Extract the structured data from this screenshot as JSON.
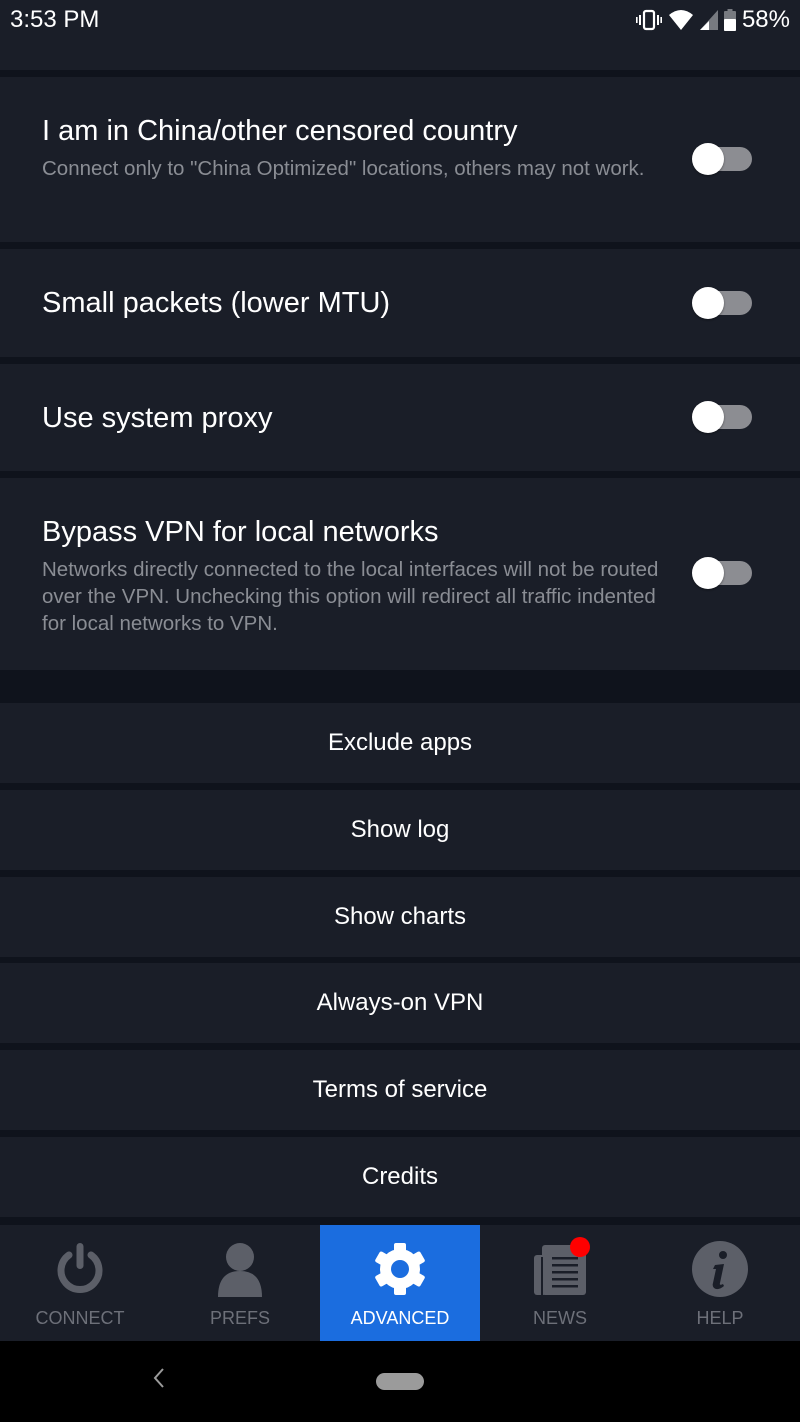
{
  "status_bar": {
    "time": "3:53 PM",
    "icons": [
      "vibrate-icon",
      "wifi-icon",
      "cell-signal-icon",
      "battery-icon"
    ],
    "battery": "58%"
  },
  "settings": [
    {
      "title": "I am in China/other censored country",
      "description": "Connect only to \"China Optimized\" locations, others may not work.",
      "enabled": false
    },
    {
      "title": "Small packets (lower MTU)",
      "description": "",
      "enabled": false
    },
    {
      "title": "Use system proxy",
      "description": "",
      "enabled": false
    },
    {
      "title": "Bypass VPN for local networks",
      "description": "Networks directly connected to the local interfaces will not be routed over the VPN. Unchecking this option will redirect all traffic indented for local networks to VPN.",
      "enabled": false
    }
  ],
  "actions": [
    {
      "label": "Exclude apps"
    },
    {
      "label": "Show log"
    },
    {
      "label": "Show charts"
    },
    {
      "label": "Always-on VPN"
    },
    {
      "label": "Terms of service"
    },
    {
      "label": "Credits"
    }
  ],
  "bottom_nav": {
    "items": [
      {
        "label": "CONNECT",
        "icon": "power-icon",
        "active": false
      },
      {
        "label": "PREFS",
        "icon": "user-icon",
        "active": false
      },
      {
        "label": "ADVANCED",
        "icon": "gear-icon",
        "active": true
      },
      {
        "label": "NEWS",
        "icon": "newspaper-icon",
        "active": false,
        "badge": true
      },
      {
        "label": "HELP",
        "icon": "info-icon",
        "active": false
      }
    ]
  },
  "colors": {
    "background": "#0f131c",
    "card": "#1a1e28",
    "accent": "#1b6ddf",
    "muted_text": "#8a8d94",
    "nav_inactive": "#6d7079",
    "badge": "#ff0000"
  }
}
